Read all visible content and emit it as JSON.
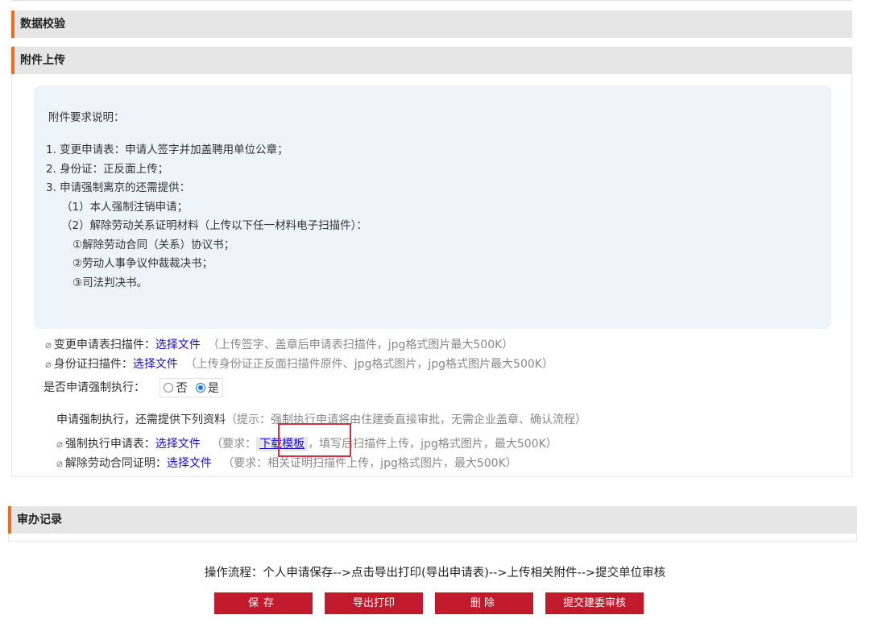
{
  "sections": {
    "check_title": "数据校验",
    "attach_title": "附件上传",
    "record_title": "审办记录"
  },
  "requirements": {
    "title": "附件要求说明：",
    "lines": [
      "1. 变更申请表：申请人签字并加盖聘用单位公章；",
      "2. 身份证：正反面上传；",
      "3. 申请强制离京的还需提供：",
      "（1）本人强制注销申请；",
      "（2）解除劳动关系证明材料（上传以下任一材料电子扫描件）：",
      "①解除劳动合同（关系）协议书；",
      "②劳动人事争议仲裁裁决书；",
      "③司法判决书。"
    ]
  },
  "uploads": [
    {
      "label": "变更申请表扫描件：",
      "link": "选择文件",
      "hint": "（上传签字、盖章后申请表扫描件，jpg格式图片最大500K）"
    },
    {
      "label": "身份证扫描件：",
      "link": "选择文件",
      "hint": "（上传身份证正反面扫描件原件、jpg格式图片，jpg格式图片最大500K）"
    }
  ],
  "force": {
    "question": "是否申请强制执行：",
    "option_no": "否",
    "option_yes": "是",
    "selected": "是",
    "note_main": "申请强制执行，还需提供下列资料",
    "note_hint": "（提示：强制执行申请将由住建委直接审批，无需企业盖章、确认流程）",
    "items": [
      {
        "label": "强制执行申请表：",
        "link": "选择文件",
        "hint_pre": "（要求：",
        "download": "下载模板",
        "hint_post": "，填写后扫描件上传，jpg格式图片，最大500K）"
      },
      {
        "label": "解除劳动合同证明：",
        "link": "选择文件",
        "hint": "（要求：相关证明扫描件上传，jpg格式图片，最大500K）"
      }
    ]
  },
  "flow": "操作流程：个人申请保存-->点击导出打印(导出申请表)-->上传相关附件-->提交单位审核",
  "buttons": {
    "save": "保存",
    "export": "导出打印",
    "delete": "删除",
    "submit": "提交建委审核"
  },
  "colors": {
    "accent": "#ec6d1f",
    "button": "#c01a2c",
    "link": "#1a0dd6",
    "highlight": "#d6303f"
  },
  "icons": {
    "attachment": "paperclip-icon"
  }
}
